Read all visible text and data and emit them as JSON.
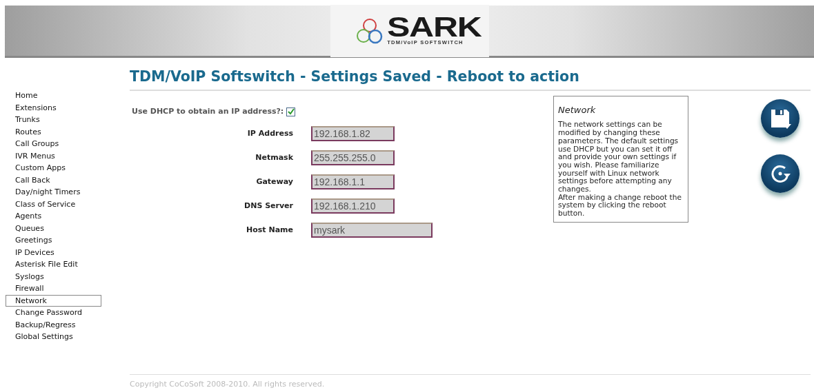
{
  "header": {
    "logo_text": "SARK",
    "logo_tagline": "TDM/VoIP SOFTSWITCH"
  },
  "page_title": "TDM/VoIP Softswitch - Settings Saved - Reboot to action",
  "sidebar": {
    "items": [
      {
        "label": "Home",
        "selected": false
      },
      {
        "label": "Extensions",
        "selected": false
      },
      {
        "label": "Trunks",
        "selected": false
      },
      {
        "label": "Routes",
        "selected": false
      },
      {
        "label": "Call Groups",
        "selected": false
      },
      {
        "label": "IVR Menus",
        "selected": false
      },
      {
        "label": "Custom Apps",
        "selected": false
      },
      {
        "label": "Call Back",
        "selected": false
      },
      {
        "label": "Day/night Timers",
        "selected": false
      },
      {
        "label": "Class of Service",
        "selected": false
      },
      {
        "label": "Agents",
        "selected": false
      },
      {
        "label": "Queues",
        "selected": false
      },
      {
        "label": "Greetings",
        "selected": false
      },
      {
        "label": "IP Devices",
        "selected": false
      },
      {
        "label": "Asterisk File Edit",
        "selected": false
      },
      {
        "label": "Syslogs",
        "selected": false
      },
      {
        "label": "Firewall",
        "selected": false
      },
      {
        "label": "Network",
        "selected": true
      },
      {
        "label": "Change Password",
        "selected": false
      },
      {
        "label": "Backup/Regress",
        "selected": false
      },
      {
        "label": "Global Settings",
        "selected": false
      }
    ]
  },
  "dhcp": {
    "label": "Use DHCP to obtain an IP address?:",
    "checked": true
  },
  "fields": [
    {
      "label": "IP Address",
      "value": "192.168.1.82",
      "kind": "short"
    },
    {
      "label": "Netmask",
      "value": "255.255.255.0",
      "kind": "short"
    },
    {
      "label": "Gateway",
      "value": "192.168.1.1",
      "kind": "short"
    },
    {
      "label": "DNS Server",
      "value": "192.168.1.210",
      "kind": "short"
    },
    {
      "label": "Host Name",
      "value": "mysark",
      "kind": "long"
    }
  ],
  "help": {
    "title": "Network",
    "paragraphs": [
      "The network settings can be modified by changing these parameters. The default settings use DHCP but you can set it off and provide your own settings if you wish. Please familiarize yourself with Linux network settings before attempting any changes.",
      "After making a change reboot the system by clicking the reboot button."
    ]
  },
  "actions": [
    {
      "kind": "save"
    },
    {
      "kind": "reboot"
    }
  ],
  "footer": "Copyright CoCoSoft 2008-2010. All rights reserved."
}
